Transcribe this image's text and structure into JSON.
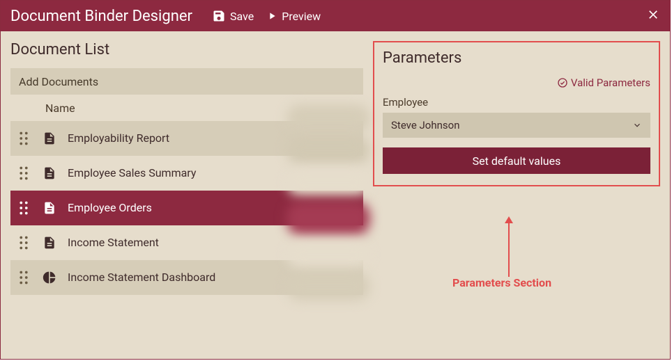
{
  "colors": {
    "accent": "#8d2940",
    "annotation": "#e24d4d"
  },
  "titlebar": {
    "title": "Document Binder Designer",
    "save": "Save",
    "preview": "Preview"
  },
  "left": {
    "heading": "Document List",
    "add": "Add Documents",
    "name_col": "Name",
    "items": [
      {
        "label": "Employability Report",
        "icon": "doc",
        "selected": false
      },
      {
        "label": "Employee Sales Summary",
        "icon": "doc",
        "selected": false
      },
      {
        "label": "Employee Orders",
        "icon": "doc",
        "selected": true
      },
      {
        "label": "Income Statement",
        "icon": "doc",
        "selected": false
      },
      {
        "label": "Income Statement Dashboard",
        "icon": "chart",
        "selected": false
      }
    ]
  },
  "right": {
    "heading": "Parameters",
    "valid": "Valid Parameters",
    "field_label": "Employee",
    "field_value": "Steve Johnson",
    "button": "Set default values",
    "annotation": "Parameters Section"
  }
}
